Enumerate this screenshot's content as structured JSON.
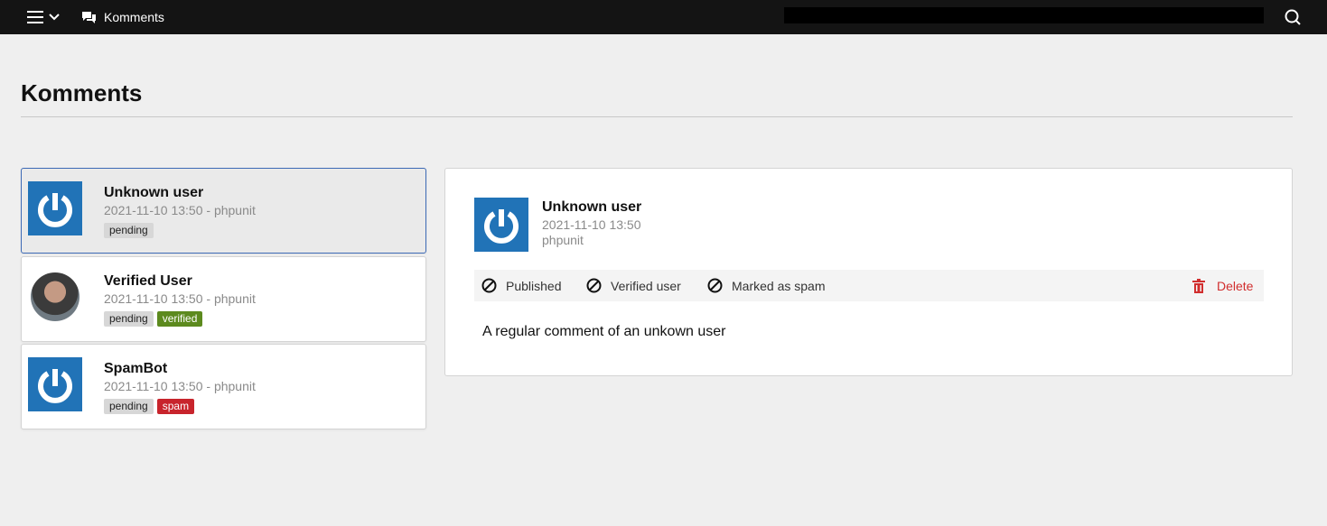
{
  "topbar": {
    "app_name": "Komments",
    "menu_icon": "hamburger-icon",
    "search_icon": "search-icon"
  },
  "page": {
    "title": "Komments"
  },
  "comments": [
    {
      "name": "Unknown user",
      "meta": "2021-11-10 13:50 - phpunit",
      "avatar": "typo3-logo-avatar",
      "badges": [
        "pending"
      ],
      "selected": true
    },
    {
      "name": "Verified User",
      "meta": "2021-11-10 13:50 - phpunit",
      "avatar": "user-photo-avatar",
      "badges": [
        "pending",
        "verified"
      ]
    },
    {
      "name": "SpamBot",
      "meta": "2021-11-10 13:50 - phpunit",
      "avatar": "typo3-logo-avatar",
      "badges": [
        "pending",
        "spam"
      ]
    }
  ],
  "detail": {
    "name": "Unknown user",
    "date": "2021-11-10 13:50",
    "author": "phpunit",
    "actions": {
      "published": "Published",
      "verified": "Verified user",
      "spam": "Marked as spam",
      "delete": "Delete"
    },
    "text": "A regular comment of an unkown user"
  },
  "colors": {
    "topbar": "#141414",
    "avatar_blue": "#2173b7",
    "verified": "#5c8a1e",
    "spam": "#c8242c",
    "delete": "#d12e2e",
    "selected_border": "#3d6ab5"
  }
}
